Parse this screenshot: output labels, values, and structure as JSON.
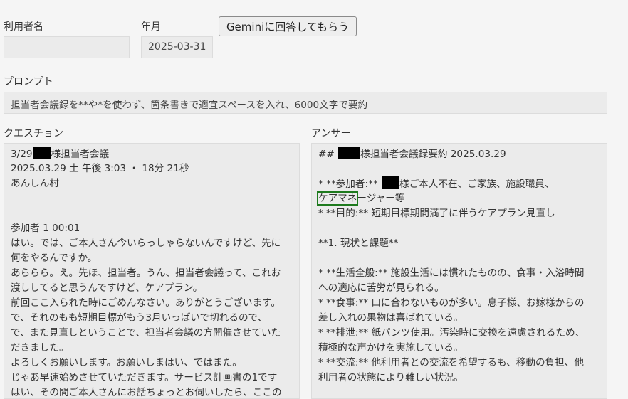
{
  "form": {
    "user_name_label": "利用者名",
    "user_name_value": "",
    "year_month_label": "年月",
    "year_month_value": "2025-03-31",
    "submit_button_label": "Geminiに回答してもらう",
    "prompt_label": "プロンプト",
    "prompt_value": "担当者会議録を**や*を使わず、箇条書きで適宜スペースを入れ、6000文字で要約"
  },
  "question": {
    "label": "クエスチョン",
    "lines": [
      "3/29",
      "様担当者会議",
      "2025.03.29 土 午後 3:03 ・ 18分 21秒",
      "あんしん村",
      "",
      "",
      "参加者 1 00:01",
      "はい。では、ご本人さん今いらっしゃらないんですけど、先に",
      "何をやるんですか。",
      "あららら。え。先ほ、担当者。うん、担当者会議って、これお",
      "渡ししてると思うんですけど、ケアプラン。",
      "前回ここ入られた時にごめんなさい。ありがとうございます。",
      "で、それのもも短期目標がもう3月いっぱいで切れるので、",
      "で、また見直しということで、担当者会議の方開催させていた",
      "だきました。",
      "よろしくお願いします。お願いしまはい、ではまた。",
      "じゃあ早速始めさせていただきます。サービス計画書の1です",
      "はい、その間ご本人さんにお話ちょっとお伺いしたら、ここの"
    ]
  },
  "answer": {
    "label": "アンサー",
    "lines": [
      "##",
      "様担当者会議録要約 2025.03.29",
      "",
      "* **参加者:**",
      "様ご本人不在、ご家族、施設職員、",
      "ケアマネ",
      "ージャー等",
      "* **目的:** 短期目標期間満了に伴うケアプラン見直し",
      "",
      "**1. 現状と課題**",
      "",
      "* **生活全般:** 施設生活には慣れたものの、食事・入浴時間",
      "への適応に苦労が見られる。",
      "* **食事:** 口に合わないものが多い。息子様、お嫁様からの",
      "差し入れの果物は喜ばれている。",
      "* **排泄:** 紙パンツ使用。汚染時に交換を遠慮されるため、",
      "積極的な声かけを実施している。",
      "* **交流:** 他利用者との交流を希望するも、移動の負担、他",
      "利用者の状態により難しい状況。"
    ]
  }
}
